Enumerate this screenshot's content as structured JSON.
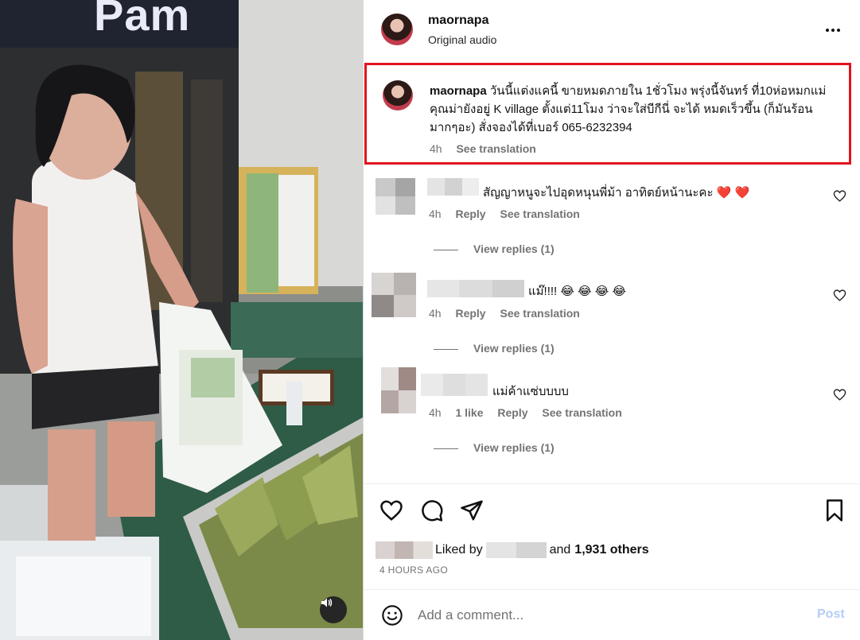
{
  "media": {
    "sign_text": "Pam",
    "sound_icon": "speaker-icon"
  },
  "post": {
    "username": "maornapa",
    "audio_label": "Original audio",
    "more_icon": "more-horizontal-icon"
  },
  "caption": {
    "username": "maornapa",
    "text": "วันนี้แต่งแคนี้ ขายหมดภายใน 1ชั่วโมง พรุ่งนี้จันทร์ ที่10ห่อหมกแม่คุณม่ายังอยู่ K village ตั้งแต่11โมง ว่าจะใส่บีกีนี่ จะได้ หมดเร็วขึ้น (ก็มันร้อนมากๆอะ) สั่งจองได้ที่เบอร์ 065-6232394",
    "time": "4h",
    "see_translation": "See translation"
  },
  "comments": [
    {
      "text": "สัญญาหนูจะไปอุดหนุนพี่ม้า อาทิตย์หน้านะคะ",
      "hearts": "❤️ ❤️",
      "time": "4h",
      "likes": "",
      "reply": "Reply",
      "see_translation": "See translation",
      "view_replies": "View replies (1)"
    },
    {
      "text": "แม๊!!!!",
      "hearts": "😂 😂 😂 😂",
      "time": "4h",
      "likes": "",
      "reply": "Reply",
      "see_translation": "See translation",
      "view_replies": "View replies (1)"
    },
    {
      "text": "แม่ค้าแซ่บบบบ",
      "hearts": "",
      "time": "4h",
      "likes": "1 like",
      "reply": "Reply",
      "see_translation": "See translation",
      "view_replies": "View replies (1)"
    }
  ],
  "actions": {
    "like_icon": "heart-icon",
    "comment_icon": "comment-icon",
    "share_icon": "send-icon",
    "save_icon": "bookmark-icon"
  },
  "likes": {
    "prefix": "Liked by",
    "connector": "and",
    "count": "1,931 others",
    "time_ago": "4 HOURS AGO"
  },
  "composer": {
    "placeholder": "Add a comment...",
    "post_label": "Post",
    "emoji_icon": "emoji-icon"
  },
  "colors": {
    "highlight_border": "#e0141d",
    "post_disabled": "#b4cdf6",
    "secondary_text": "#737373"
  }
}
